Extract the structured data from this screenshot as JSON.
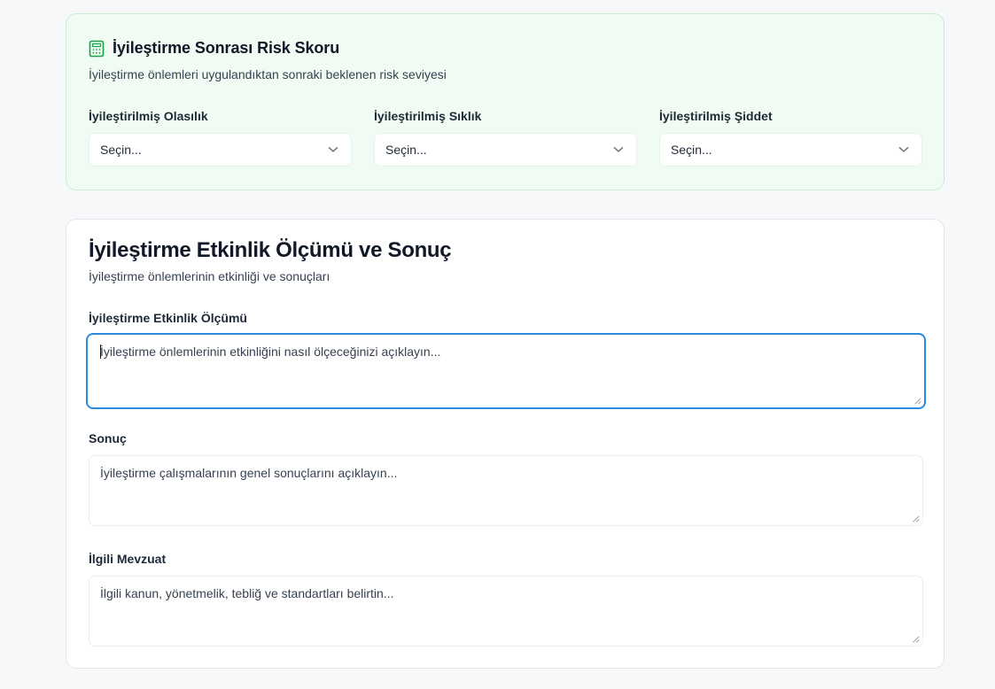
{
  "risk_section": {
    "icon": "calculator-icon",
    "title": "İyileştirme Sonrası Risk Skoru",
    "description": "İyileştirme önlemleri uygulandıktan sonraki beklenen risk seviyesi",
    "fields": [
      {
        "label": "İyileştirilmiş Olasılık",
        "value": "Seçin..."
      },
      {
        "label": "İyileştirilmiş Sıklık",
        "value": "Seçin..."
      },
      {
        "label": "İyileştirilmiş Şiddet",
        "value": "Seçin..."
      }
    ]
  },
  "effectiveness_section": {
    "title": "İyileştirme Etkinlik Ölçümü ve Sonuç",
    "description": "İyileştirme önlemlerinin etkinliği ve sonuçları",
    "measurement": {
      "label": "İyileştirme Etkinlik Ölçümü",
      "placeholder": "İyileştirme önlemlerinin etkinliğini nasıl ölçeceğinizi açıklayın..."
    },
    "result": {
      "label": "Sonuç",
      "placeholder": "İyileştirme çalışmalarının genel sonuçlarını açıklayın..."
    },
    "legislation": {
      "label": "İlgili Mevzuat",
      "placeholder": "İlgili kanun, yönetmelik, tebliğ ve standartları belirtin..."
    }
  },
  "colors": {
    "risk_card_bg": "#effbf3",
    "risk_icon": "#16a34a",
    "focus_ring": "#2b8ae0"
  }
}
